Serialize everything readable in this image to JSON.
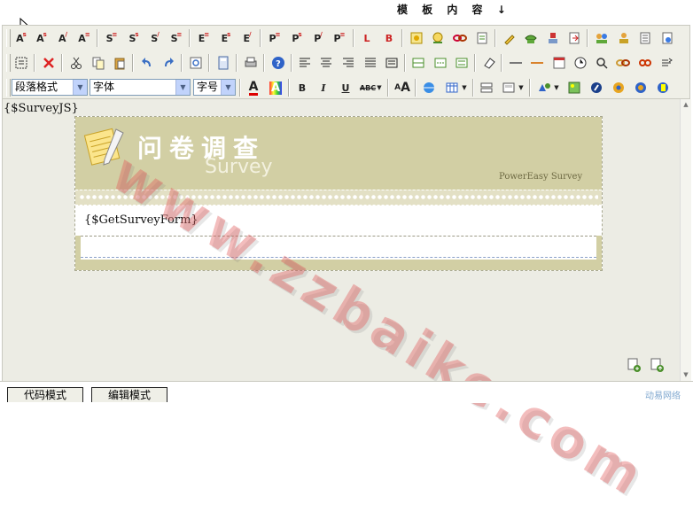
{
  "window": {
    "title": "模 板 内 容 ↓"
  },
  "toolbar": {
    "paragraph_format": "段落格式",
    "font_family": "字体",
    "font_size": "字号",
    "bold": "B",
    "italic": "I",
    "underline": "U",
    "strikethrough": "ABC"
  },
  "editor": {
    "js_placeholder": "{$SurveyJS}",
    "survey": {
      "title": "问卷调查",
      "subtitle": "Survey",
      "brand": "PowerEasy Survey",
      "form_placeholder": "{$GetSurveyForm}"
    },
    "watermark": "www.zzbaike.com"
  },
  "bottom": {
    "code_mode": "代码模式",
    "edit_mode": "编辑模式",
    "brand": "动易网络"
  },
  "colors": {
    "banner": "#d2cfa4",
    "toolbar_bg": "#efefe7",
    "editor_bg": "#ecece4",
    "watermark": "#e05a5a"
  }
}
